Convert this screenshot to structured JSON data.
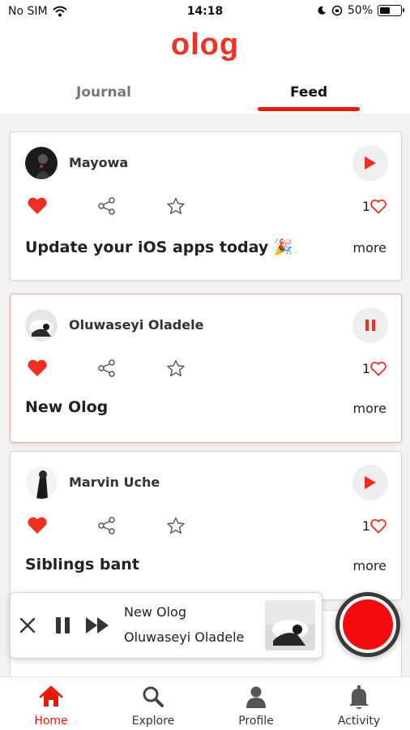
{
  "status_bar": {
    "carrier": "No SIM",
    "time": "14:18",
    "battery_text": "50%",
    "battery_level": 0.5
  },
  "app": {
    "logo": "olog"
  },
  "tabs": [
    {
      "label": "Journal",
      "selected": false
    },
    {
      "label": "Feed",
      "selected": true
    }
  ],
  "feed": [
    {
      "author": "Mayowa",
      "title": "Update your iOS apps today 🎉",
      "likes": "1",
      "more_label": "more",
      "playing": false,
      "liked": true
    },
    {
      "author": "Oluwaseyi Oladele",
      "title": "New Olog",
      "likes": "1",
      "more_label": "more",
      "playing": true,
      "liked": true
    },
    {
      "author": "Marvin Uche",
      "title": "Siblings bant",
      "likes": "1",
      "more_label": "more",
      "playing": false,
      "liked": true
    }
  ],
  "now_playing": {
    "title": "New Olog",
    "author": "Oluwaseyi Oladele"
  },
  "bottom_nav": [
    {
      "label": "Home",
      "icon": "home-icon",
      "active": true
    },
    {
      "label": "Explore",
      "icon": "search-icon",
      "active": false
    },
    {
      "label": "Profile",
      "icon": "profile-icon",
      "active": false
    },
    {
      "label": "Activity",
      "icon": "bell-icon",
      "active": false
    }
  ],
  "colors": {
    "accent": "#e8180c",
    "logo": "#ee3322",
    "record": "#f40b0b"
  }
}
